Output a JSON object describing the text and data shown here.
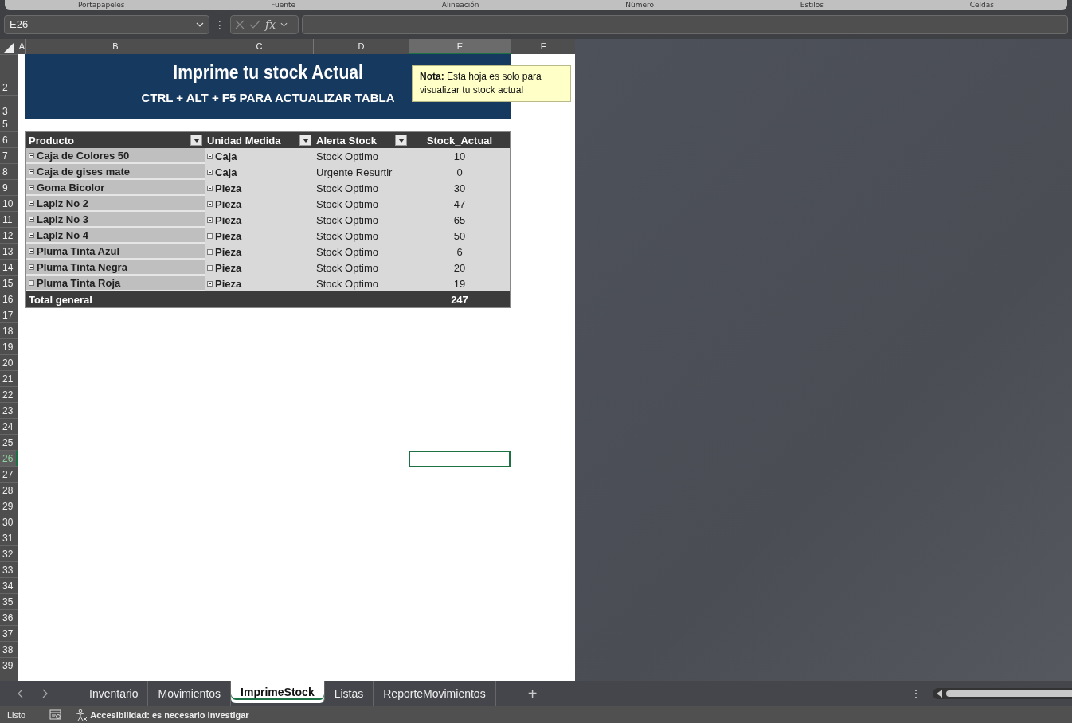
{
  "ribbon_groups": [
    "Portapapeles",
    "Fuente",
    "Alineación",
    "Número",
    "Estilos",
    "Celdas"
  ],
  "formula_bar": {
    "name_box": "E26",
    "fx": "fx",
    "more": "⋮"
  },
  "column_headers": [
    {
      "label": "A",
      "selected": false
    },
    {
      "label": "B",
      "selected": false
    },
    {
      "label": "C",
      "selected": false
    },
    {
      "label": "D",
      "selected": false
    },
    {
      "label": "E",
      "selected": true
    },
    {
      "label": "F",
      "selected": false
    }
  ],
  "row_headers": [
    {
      "label": "2",
      "selected": false
    },
    {
      "label": "3",
      "selected": false
    },
    {
      "label": "5",
      "selected": false
    },
    {
      "label": "6",
      "selected": false
    },
    {
      "label": "7",
      "selected": false
    },
    {
      "label": "8",
      "selected": false
    },
    {
      "label": "9",
      "selected": false
    },
    {
      "label": "10",
      "selected": false
    },
    {
      "label": "11",
      "selected": false
    },
    {
      "label": "12",
      "selected": false
    },
    {
      "label": "13",
      "selected": false
    },
    {
      "label": "14",
      "selected": false
    },
    {
      "label": "15",
      "selected": false
    },
    {
      "label": "16",
      "selected": false
    },
    {
      "label": "17",
      "selected": false
    },
    {
      "label": "18",
      "selected": false
    },
    {
      "label": "19",
      "selected": false
    },
    {
      "label": "20",
      "selected": false
    },
    {
      "label": "21",
      "selected": false
    },
    {
      "label": "22",
      "selected": false
    },
    {
      "label": "23",
      "selected": false
    },
    {
      "label": "24",
      "selected": false
    },
    {
      "label": "25",
      "selected": false
    },
    {
      "label": "26",
      "selected": true
    },
    {
      "label": "27",
      "selected": false
    },
    {
      "label": "28",
      "selected": false
    },
    {
      "label": "29",
      "selected": false
    },
    {
      "label": "30",
      "selected": false
    },
    {
      "label": "31",
      "selected": false
    },
    {
      "label": "32",
      "selected": false
    },
    {
      "label": "33",
      "selected": false
    },
    {
      "label": "34",
      "selected": false
    },
    {
      "label": "35",
      "selected": false
    },
    {
      "label": "36",
      "selected": false
    },
    {
      "label": "37",
      "selected": false
    },
    {
      "label": "38",
      "selected": false
    },
    {
      "label": "39",
      "selected": false
    }
  ],
  "banner": {
    "title": "Imprime tu stock Actual",
    "subtitle": "CTRL + ALT + F5 PARA ACTUALIZAR TABLA"
  },
  "note": {
    "label": "Nota:",
    "text": "Esta hoja es solo para visualizar tu stock actual"
  },
  "table": {
    "columns": [
      {
        "label": "Producto",
        "filter": true
      },
      {
        "label": "Unidad Medida",
        "filter": true
      },
      {
        "label": "Alerta Stock",
        "filter": true
      },
      {
        "label": "Stock_Actual",
        "filter": false
      }
    ],
    "rows": [
      {
        "producto": "Caja de Colores 50",
        "unidad": "Caja",
        "alerta": "Stock Optimo",
        "stock": "10"
      },
      {
        "producto": "Caja de gises mate",
        "unidad": "Caja",
        "alerta": "Urgente Resurtir",
        "stock": "0"
      },
      {
        "producto": "Goma Bicolor",
        "unidad": "Pieza",
        "alerta": "Stock Optimo",
        "stock": "30"
      },
      {
        "producto": "Lapiz No 2",
        "unidad": "Pieza",
        "alerta": "Stock Optimo",
        "stock": "47"
      },
      {
        "producto": "Lapiz No 3",
        "unidad": "Pieza",
        "alerta": "Stock Optimo",
        "stock": "65"
      },
      {
        "producto": "Lapiz No 4",
        "unidad": "Pieza",
        "alerta": "Stock Optimo",
        "stock": "50"
      },
      {
        "producto": "Pluma Tinta Azul",
        "unidad": "Pieza",
        "alerta": "Stock Optimo",
        "stock": "6"
      },
      {
        "producto": "Pluma Tinta Negra",
        "unidad": "Pieza",
        "alerta": "Stock Optimo",
        "stock": "20"
      },
      {
        "producto": "Pluma Tinta Roja",
        "unidad": "Pieza",
        "alerta": "Stock Optimo",
        "stock": "19"
      }
    ],
    "total": {
      "label": "Total general",
      "stock": "247"
    }
  },
  "sheet_tabs": [
    {
      "label": "Inventario",
      "selected": false
    },
    {
      "label": "Movimientos",
      "selected": false
    },
    {
      "label": "ImprimeStock",
      "selected": true
    },
    {
      "label": "Listas",
      "selected": false
    },
    {
      "label": "ReporteMovimientos",
      "selected": false
    }
  ],
  "add_sheet": "+",
  "tab_more": "⋮",
  "status_bar": {
    "state": "Listo",
    "accessibility": "Accesibilidad: es necesario investigar"
  }
}
